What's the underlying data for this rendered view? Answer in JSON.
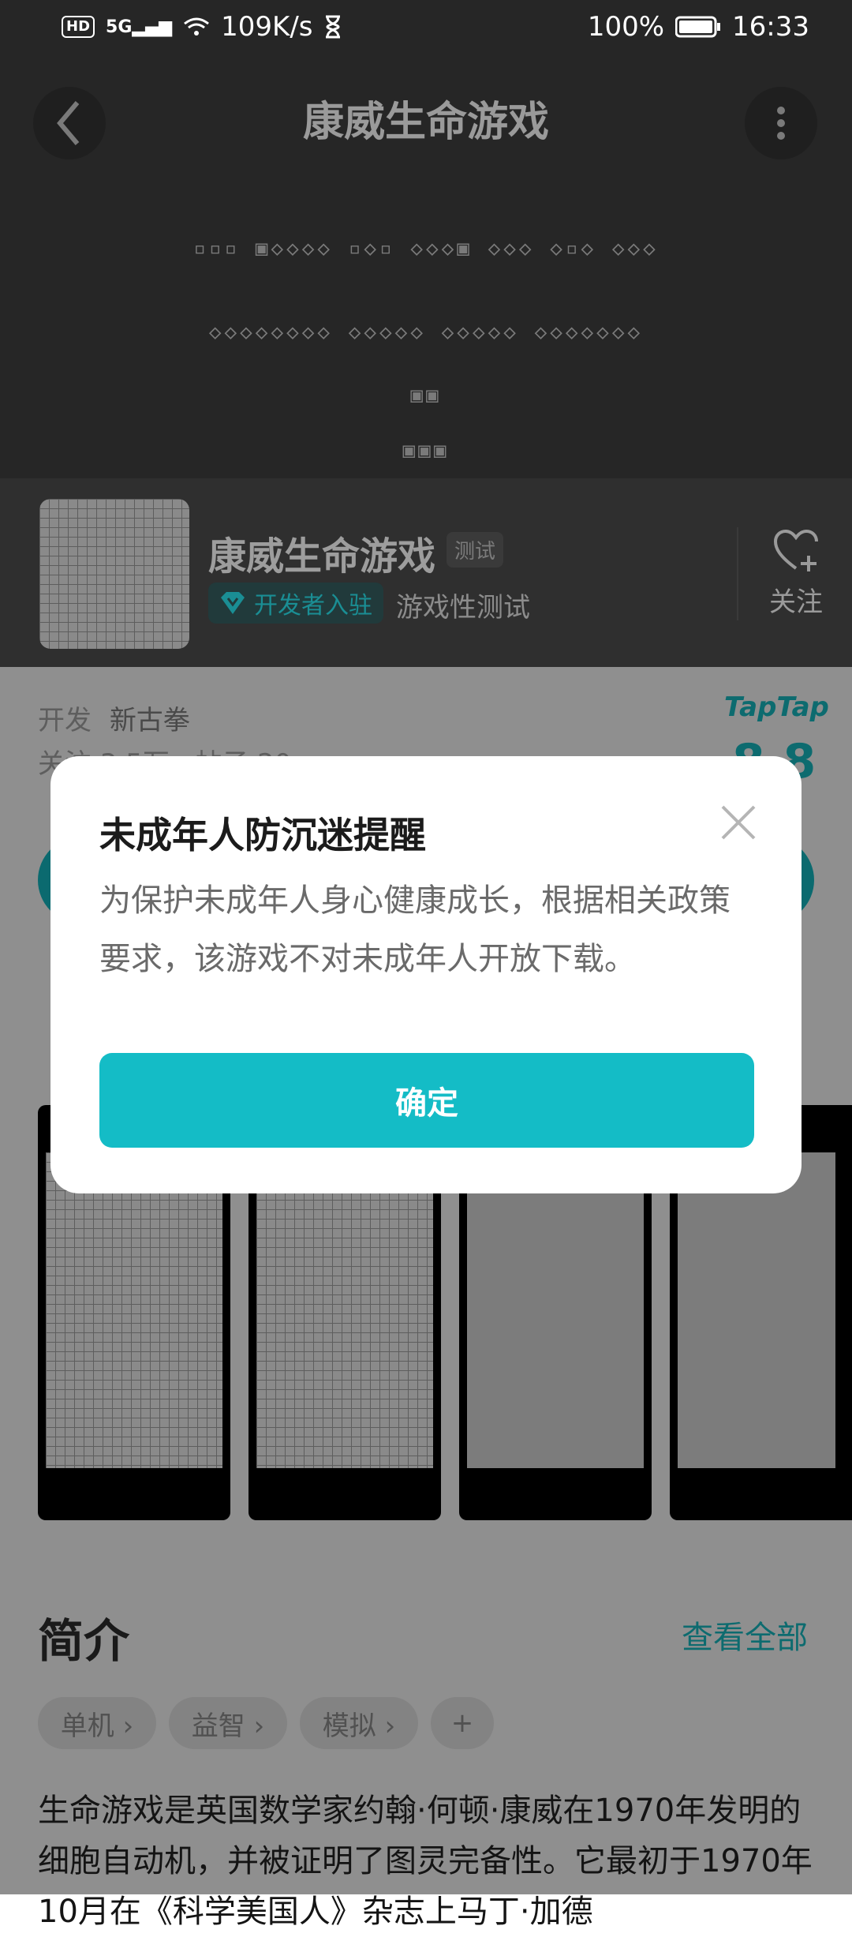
{
  "status_bar": {
    "hd": "HD",
    "signal": "5G",
    "speed": "109K/s",
    "battery": "100%",
    "time": "16:33"
  },
  "header": {
    "title": "康威生命游戏",
    "pattern_lines": [
      "▫▫▫ ▣◇◇◇◇ ▫◇▫ ◇◇◇▣ ◇◇◇ ◇▫◇ ◇◇◇",
      "◇◇◇◇◇◇◇◇ ◇◇◇◇◇ ◇◇◇◇◇ ◇◇◇◇◇◇◇",
      "▣▣",
      "▣▣▣"
    ]
  },
  "app": {
    "name": "康威生命游戏",
    "tag": "测试",
    "dev_badge": "开发者入驻",
    "dev_suffix": "游戏性测试",
    "follow_label": "关注"
  },
  "info": {
    "developer_label": "开发",
    "developer_name": "新古拳",
    "stats": "关注 3.5万 · 帖子 20",
    "platform": "TapTap",
    "rating": "8.8"
  },
  "intro": {
    "title": "简介",
    "see_all": "查看全部",
    "tags": [
      "单机 ›",
      "益智 ›",
      "模拟 ›",
      "+"
    ],
    "text": "生命游戏是英国数学家约翰·何顿·康威在1970年发明的细胞自动机，并被证明了图灵完备性。它最初于1970年10月在《科学美国人》杂志上马丁·加德"
  },
  "dialog": {
    "title": "未成年人防沉迷提醒",
    "message": "为保护未成年人身心健康成长，根据相关政策要求，该游戏不对未成年人开放下载。",
    "confirm": "确定"
  },
  "colors": {
    "accent": "#14bcc6",
    "header_bg": "#262626"
  }
}
